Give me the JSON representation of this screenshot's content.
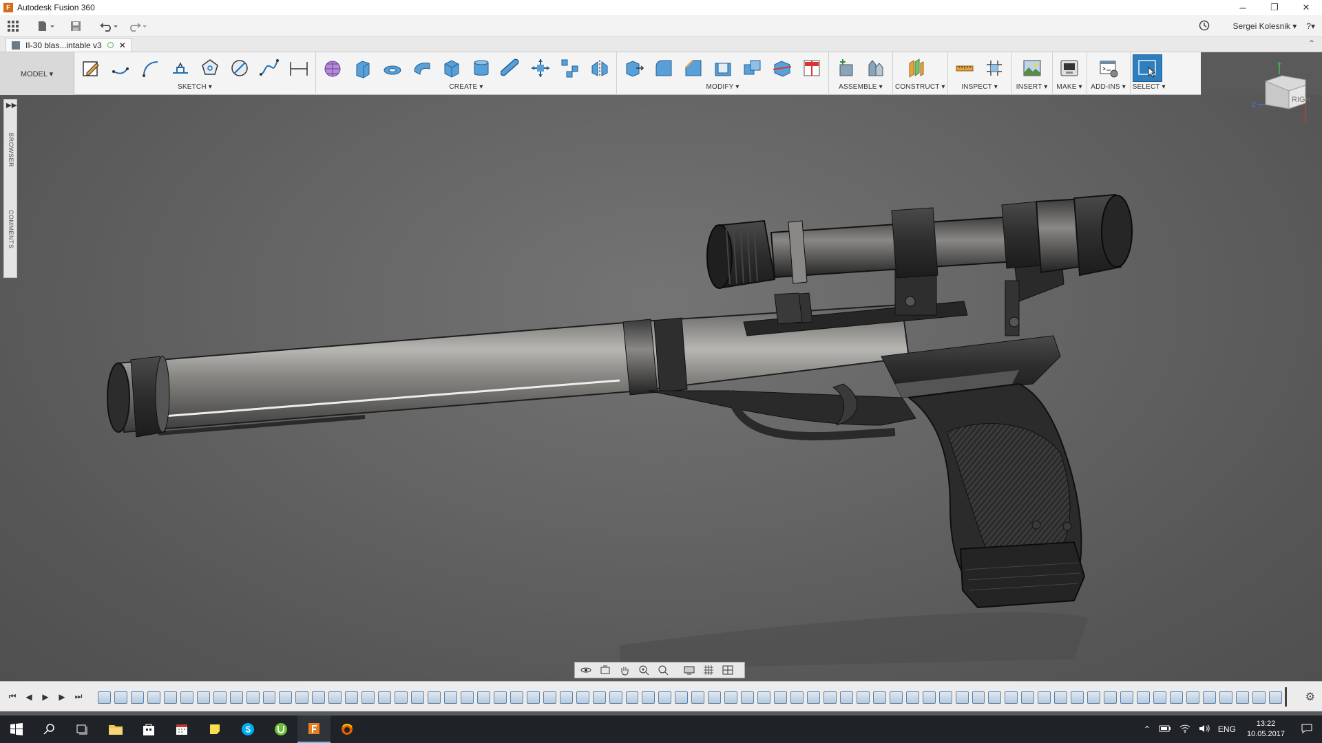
{
  "window": {
    "title": "Autodesk Fusion 360",
    "app_icon_letter": "F",
    "controls": {
      "minimize": "─",
      "restore": "❐",
      "close": "✕"
    }
  },
  "quick_access": {
    "user_name": "Sergei Kolesnik ▾",
    "help": "?▾"
  },
  "document": {
    "tab_name": "II-30 blas...intable v3",
    "close_glyph": "✕"
  },
  "toolbar": {
    "workspace": "MODEL ▾",
    "groups": {
      "sketch": "SKETCH ▾",
      "create": "CREATE ▾",
      "modify": "MODIFY ▾",
      "assemble": "ASSEMBLE ▾",
      "construct": "CONSTRUCT ▾",
      "inspect": "INSPECT ▾",
      "insert": "INSERT ▾",
      "make": "MAKE ▾",
      "addins": "ADD-INS ▾",
      "select": "SELECT ▾"
    }
  },
  "side_panel": {
    "expand": "▶▶",
    "browser_label": "BROWSER",
    "comments_label": "COMMENTS"
  },
  "viewcube": {
    "face_label": "RIGHT",
    "axis_y": "Y",
    "axis_z": "Z",
    "axis_x": "X"
  },
  "timeline": {
    "first": "⏮",
    "prev": "◀",
    "play": "▶",
    "next": "▶",
    "last": "⏭",
    "settings": "⚙"
  },
  "taskbar": {
    "language": "ENG",
    "time": "13:22",
    "date": "10.05.2017"
  },
  "colors": {
    "accent": "#2f7fbf",
    "viewport_bg": "#656565",
    "taskbar_bg": "#1f2226"
  }
}
